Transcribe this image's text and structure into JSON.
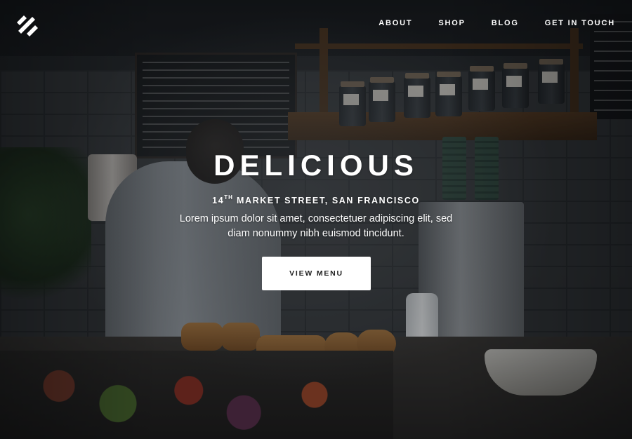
{
  "nav": {
    "items": [
      {
        "label": "ABOUT"
      },
      {
        "label": "SHOP"
      },
      {
        "label": "BLOG"
      },
      {
        "label": "GET IN TOUCH"
      }
    ]
  },
  "hero": {
    "title": "DELICIOUS",
    "address_number": "14",
    "address_suffix": "TH",
    "address_rest": " MARKET STREET, SAN FRANCISCO",
    "description": "Lorem ipsum dolor sit amet, consectetuer adipiscing elit, sed diam nonummy nibh euismod tincidunt.",
    "cta_label": "VIEW MENU"
  },
  "colors": {
    "text": "#ffffff",
    "button_bg": "#ffffff",
    "button_text": "#222222"
  },
  "icons": {
    "logo": "diagonal-stripes-logo-icon"
  }
}
